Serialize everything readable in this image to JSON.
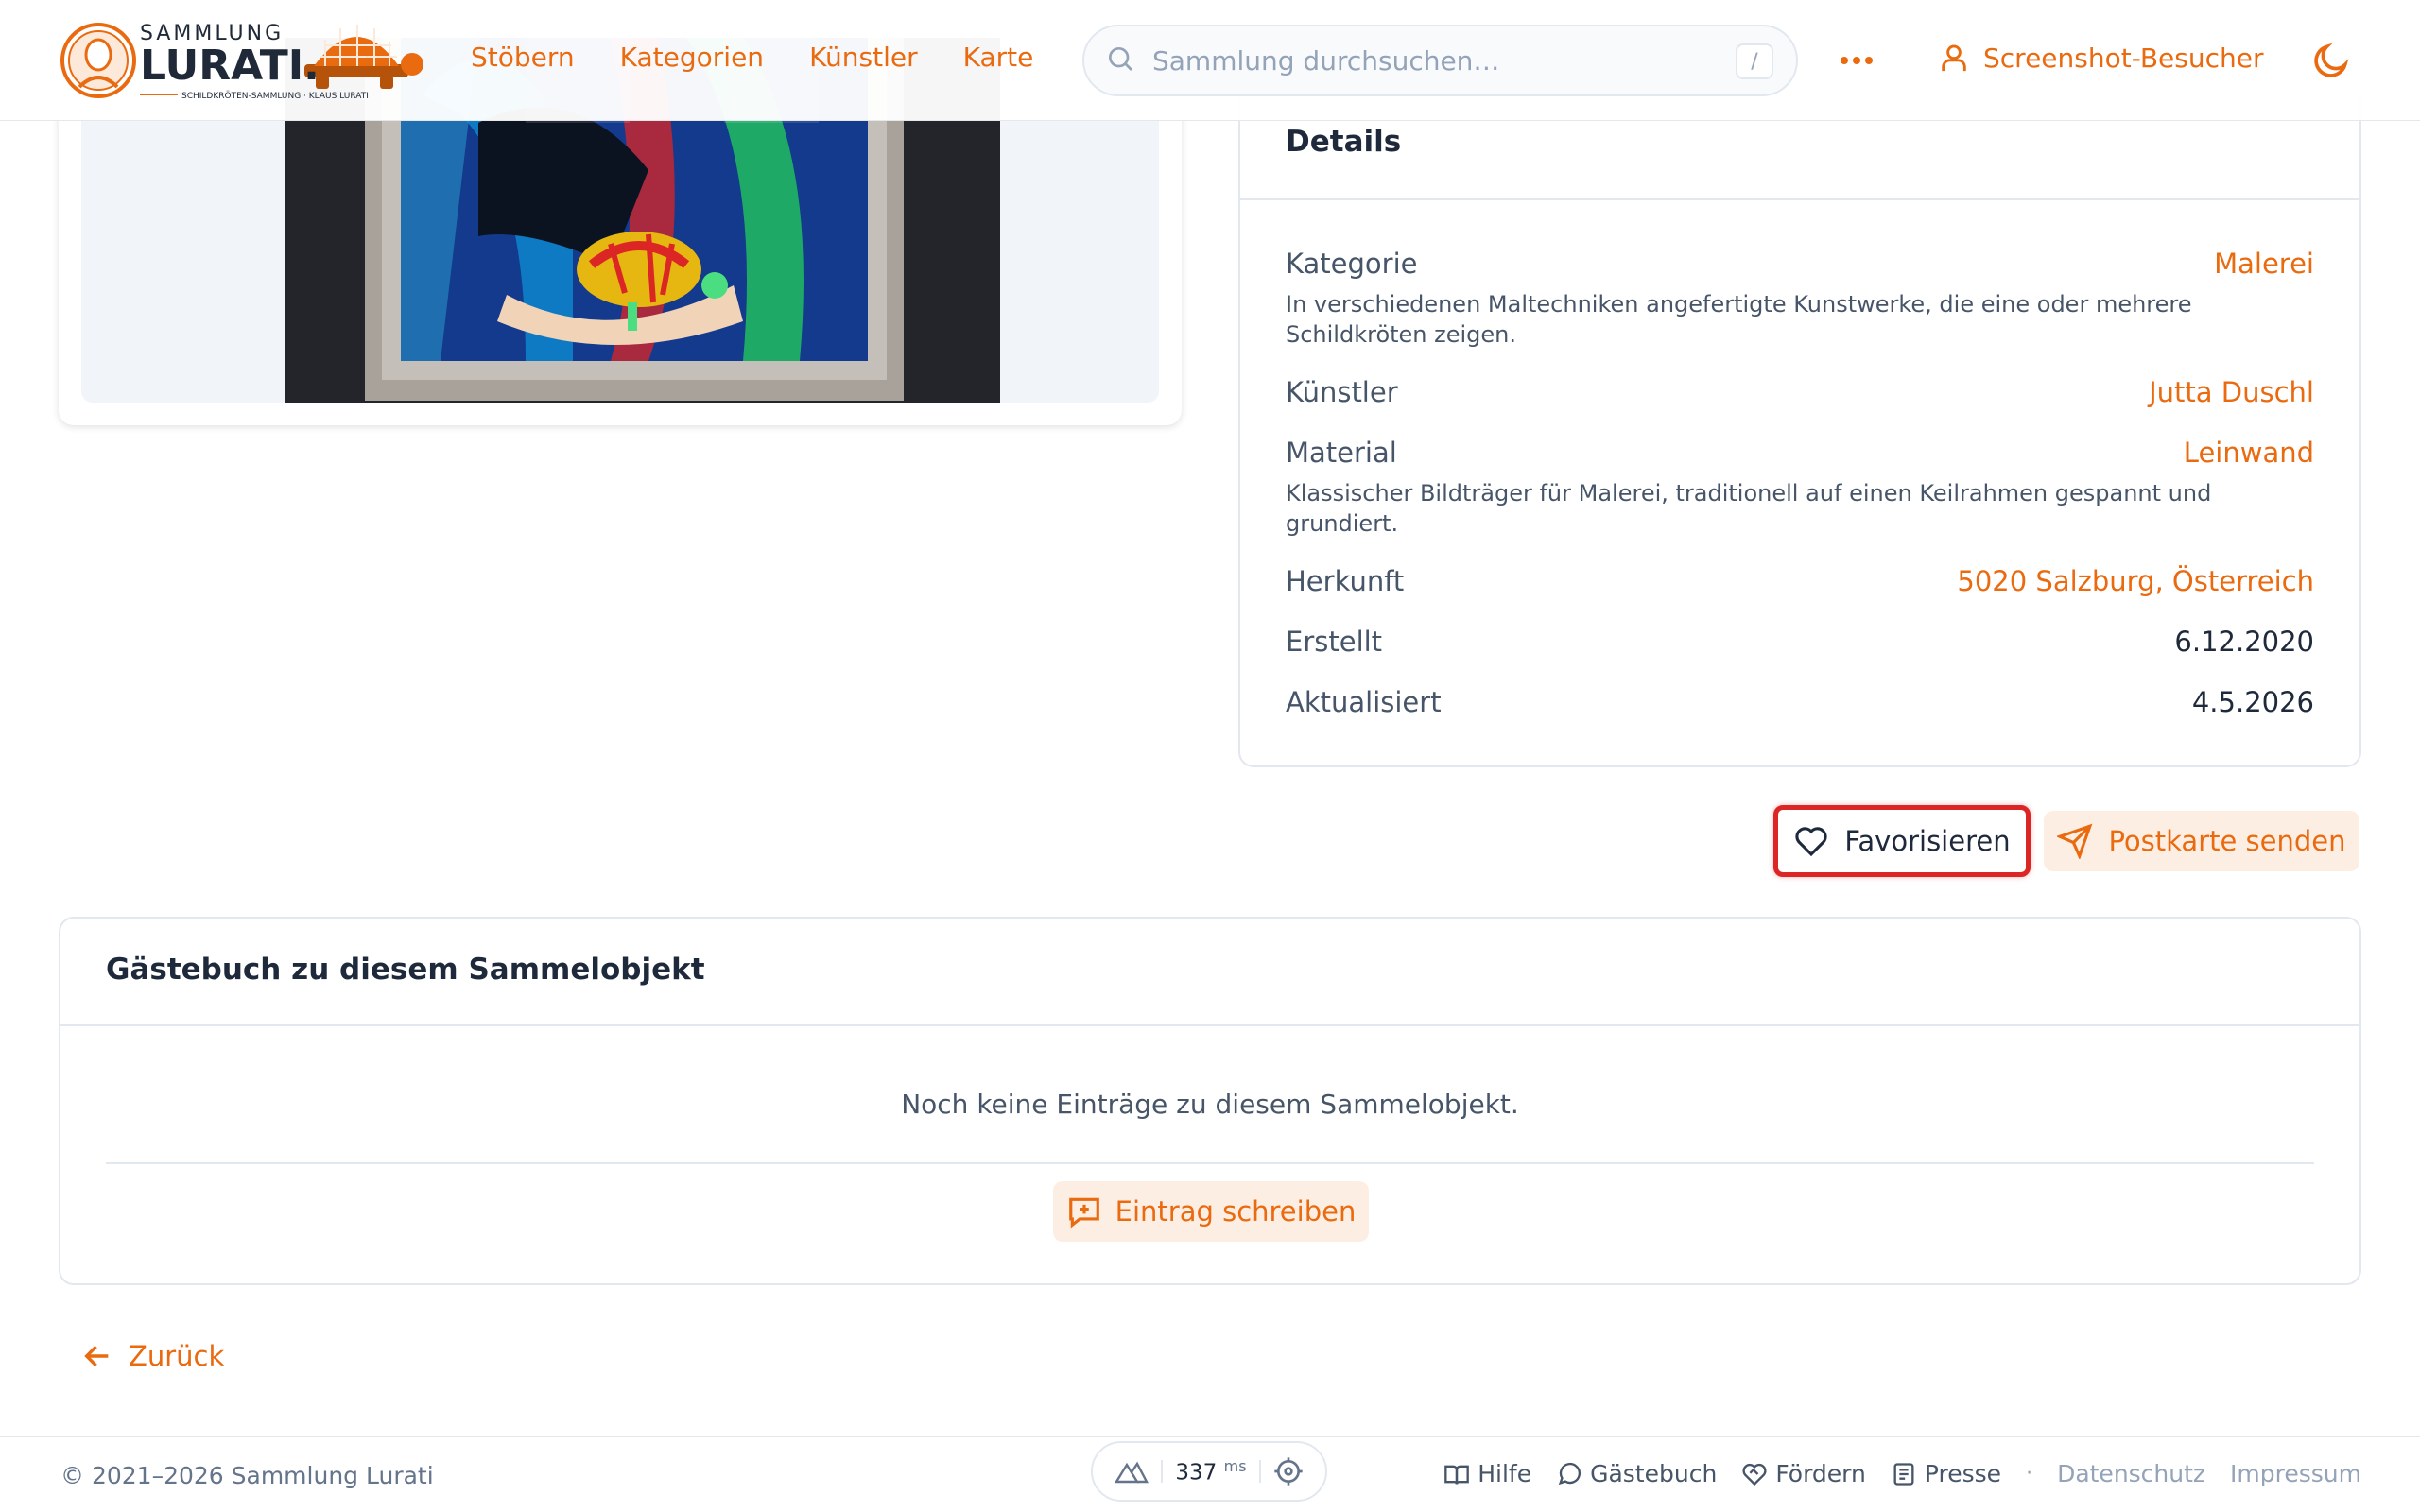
{
  "header": {
    "logo": {
      "top_text": "SAMMLUNG",
      "main_text": "LURATI.",
      "tagline": "SCHILDKRÖTEN-SAMMLUNG · KLAUS LURATI"
    },
    "nav": [
      "Stöbern",
      "Kategorien",
      "Künstler",
      "Karte"
    ],
    "search": {
      "placeholder": "Sammlung durchsuchen…",
      "shortcut": "/"
    },
    "user_label": "Screenshot-Besucher"
  },
  "details": {
    "title": "Details",
    "rows": [
      {
        "label": "Kategorie",
        "value": "Malerei",
        "link": true,
        "description": "In verschiedenen Maltechniken angefertigte Kunstwerke, die eine oder mehrere Schildkröten zeigen."
      },
      {
        "label": "Künstler",
        "value": "Jutta Duschl",
        "link": true
      },
      {
        "label": "Material",
        "value": "Leinwand",
        "link": true,
        "description": "Klassischer Bildträger für Malerei, traditionell auf einen Keilrahmen gespannt und grundiert."
      },
      {
        "label": "Herkunft",
        "value": "5020 Salzburg, Österreich",
        "link": true
      },
      {
        "label": "Erstellt",
        "value": "6.12.2020",
        "link": false
      },
      {
        "label": "Aktualisiert",
        "value": "4.5.2026",
        "link": false
      }
    ]
  },
  "actions": {
    "favorite": "Favorisieren",
    "postcard": "Postkarte senden"
  },
  "guestbook": {
    "title": "Gästebuch zu diesem Sammelobjekt",
    "empty": "Noch keine Einträge zu diesem Sammelobjekt.",
    "write": "Eintrag schreiben"
  },
  "back": "Zurück",
  "footer": {
    "copyright": "© 2021–2026 Sammlung Lurati",
    "perf_value": "337",
    "perf_unit": "ms",
    "links": [
      "Hilfe",
      "Gästebuch",
      "Fördern",
      "Presse"
    ],
    "separator": "·",
    "legal": [
      "Datenschutz",
      "Impressum"
    ]
  },
  "colors": {
    "accent": "#ea6a10",
    "highlight": "#dc2626",
    "text": "#334155"
  }
}
